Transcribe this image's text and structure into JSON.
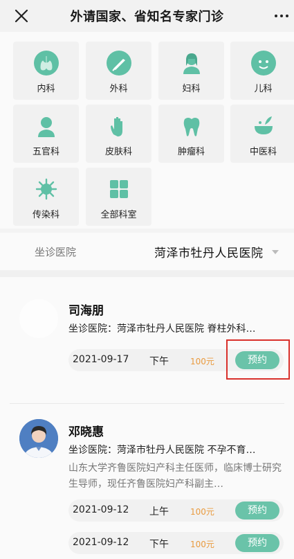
{
  "header": {
    "title": "外请国家、省知名专家门诊"
  },
  "departments": [
    {
      "label": "内科",
      "icon": "lungs-icon"
    },
    {
      "label": "外科",
      "icon": "scalpel-icon"
    },
    {
      "label": "妇科",
      "icon": "woman-icon"
    },
    {
      "label": "儿科",
      "icon": "child-face-icon"
    },
    {
      "label": "五官科",
      "icon": "person-bust-icon"
    },
    {
      "label": "皮肤科",
      "icon": "hand-icon"
    },
    {
      "label": "肿瘤科",
      "icon": "tooth-icon"
    },
    {
      "label": "中医科",
      "icon": "herbal-bowl-icon"
    },
    {
      "label": "传染科",
      "icon": "virus-icon"
    },
    {
      "label": "全部科室",
      "icon": "grid-icon"
    }
  ],
  "hospital_filter": {
    "label": "坐诊医院",
    "value": "菏泽市牡丹人民医院"
  },
  "doctors": [
    {
      "name": "司海朋",
      "hospital_line": "坐诊医院：菏泽市牡丹人民医院 脊柱外科…",
      "slots": [
        {
          "date": "2021-09-17",
          "period": "下午",
          "price": "100元",
          "button": "预约"
        }
      ]
    },
    {
      "name": "邓晓惠",
      "hospital_line": "坐诊医院：菏泽市牡丹人民医院 不孕不育…",
      "description": "山东大学齐鲁医院妇产科主任医师，临床博士研究生导师，现任齐鲁医院妇产科副主…",
      "slots": [
        {
          "date": "2021-09-12",
          "period": "上午",
          "price": "100元",
          "button": "预约"
        },
        {
          "date": "2021-09-12",
          "period": "下午",
          "price": "100元",
          "button": "预约"
        }
      ]
    }
  ],
  "colors": {
    "accent": "#6ac3a9",
    "price": "#e99a3e",
    "highlight": "#d9302b",
    "icon": "#5fc0a5"
  }
}
